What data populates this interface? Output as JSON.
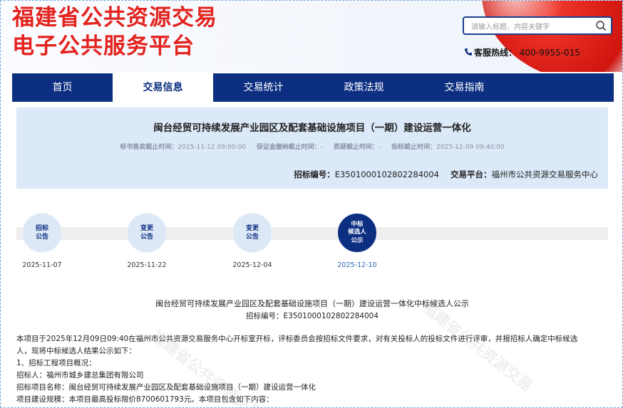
{
  "header": {
    "logo_line1": "福建省公共资源交易",
    "logo_line2": "电子公共服务平台",
    "search_placeholder": "请输入标题、内容关键字",
    "hotline_label": "客服热线：",
    "hotline_number": "400-9955-015"
  },
  "nav": {
    "items": [
      {
        "label": "首页"
      },
      {
        "label": "交易信息"
      },
      {
        "label": "交易统计"
      },
      {
        "label": "政策法规"
      },
      {
        "label": "交易指南"
      }
    ],
    "active_index": 1
  },
  "project": {
    "title": "闽台经贸可持续发展产业园区及配套基础设施项目（一期）建设运营一体化",
    "times": [
      {
        "label": "标书售卖截止时间：",
        "value": "2025-11-12 09:00:00"
      },
      {
        "label": "保证金缴纳截止时间：",
        "value": "-"
      },
      {
        "label": "质疑截止时间：",
        "value": "-"
      },
      {
        "label": "投标截止时间：",
        "value": "2025-12-09 09:40:00"
      }
    ],
    "bid_no_label": "招标编号：",
    "bid_no": "E3501000102802284004",
    "platform_label": "交易平台：",
    "platform": "福州市公共资源交易服务中心"
  },
  "timeline": [
    {
      "label": "招标\n公告",
      "date": "2025-11-07",
      "active": false
    },
    {
      "label": "变更\n公告",
      "date": "2025-11-22",
      "active": false
    },
    {
      "label": "变更\n公告",
      "date": "2025-12-04",
      "active": false
    },
    {
      "label": "中标\n候选人\n公示",
      "date": "2025-12-10",
      "active": true
    }
  ],
  "document": {
    "title": "闽台经贸可持续发展产业园区及配套基础设施项目（一期）建设运营一体化中标候选人公示",
    "bid_no_line": "招标编号：E3501000102802284004",
    "lines": [
      "本项目于2025年12月09日09:40在福州市公共资源交易服务中心开标室开标，评标委员会按招标文件要求，对有关投标人的投标文件进行评审，并报招标人确定中标候选",
      "人，现将中标候选人结果公示如下：",
      "1、招标工程项目概况：",
      "招标人：福州市城乡建总集团有限公司",
      "招标项目名称：闽台经贸可持续发展产业园区及配套基础设施项目（一期）建设运营一体化",
      "项目建设规模：本项目最高投标限价8700601793元。本项目包含如下内容："
    ],
    "watermark": "福建省公共资源交易"
  },
  "colors": {
    "brand_red": "#e3231f",
    "nav_blue": "#0d2f82",
    "panel_blue": "#dce9f8",
    "active_date": "#2d64b7"
  }
}
